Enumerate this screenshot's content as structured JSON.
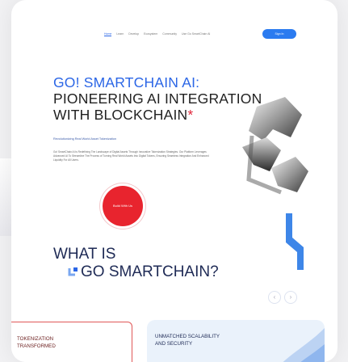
{
  "nav": {
    "links": [
      "Home",
      "Learn",
      "Develop",
      "Ecosystem",
      "Community",
      "Use Go SmartChain AI"
    ],
    "signin_label": "Sign In"
  },
  "hero": {
    "title_line1": "GO! SMARTCHAIN AI:",
    "title_line2": "PIONEERING AI INTEGRATION",
    "title_line3": "WITH BLOCKCHAIN",
    "title_star": "*",
    "subtitle": "Revolutionizing Real World Asset Tokenization",
    "description": "Go! SmartChain AI is Redefining The Landscape of Digital Assets Through Innovative Tokenization Strategies. Our Platform Leverages Advanced AI To Streamline The Process of Turning Real World Assets Into Digital Tokens, Ensuring Seamless Integration And Enhanced Liquidity For All Users.",
    "cta_label": "Build With Us"
  },
  "what": {
    "line1": "WHAT IS",
    "line2": "GO  SMARTCHAIN?"
  },
  "carousel": {
    "prev_icon": "chevron-left-icon",
    "next_icon": "chevron-right-icon"
  },
  "cards": [
    {
      "line1": "TOKENIZATION",
      "line2": "TRANSFORMED"
    },
    {
      "line1": "UNMATCHED SCALABILITY",
      "line2": "AND SECURITY"
    }
  ],
  "colors": {
    "accent_blue": "#2b66e6",
    "cta_red": "#e8242e",
    "heading_dark": "#1e2a55"
  }
}
